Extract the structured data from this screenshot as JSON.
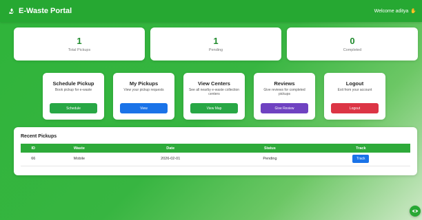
{
  "navbar": {
    "brand": "E-Waste Portal",
    "brand_icon": "recycle-icon",
    "welcome": "Welcome aditya",
    "welcome_icon": "wave-icon"
  },
  "stats": [
    {
      "value": "1",
      "label": "Total Pickups"
    },
    {
      "value": "1",
      "label": "Pending"
    },
    {
      "value": "0",
      "label": "Completed"
    }
  ],
  "actions": [
    {
      "title": "Schedule Pickup",
      "desc": "Book pickup for e-waste",
      "button": "Schedule",
      "color": "#28a745"
    },
    {
      "title": "My Pickups",
      "desc": "View your pickup requests",
      "button": "View",
      "color": "#1a73e8"
    },
    {
      "title": "View Centers",
      "desc": "See all nearby e-waste collection centers",
      "button": "View Map",
      "color": "#28a745"
    },
    {
      "title": "Reviews",
      "desc": "Give reviews for completed pickups",
      "button": "Give Review",
      "color": "#6f42c1"
    },
    {
      "title": "Logout",
      "desc": "Exit from your account",
      "button": "Logout",
      "color": "#dc3545"
    }
  ],
  "recent": {
    "title": "Recent Pickups",
    "columns": [
      "ID",
      "Waste",
      "Date",
      "Status",
      "Track"
    ],
    "rows": [
      {
        "id": "66",
        "waste": "Mobile",
        "date": "2026-02-01",
        "status": "Pending",
        "track": "Track"
      }
    ]
  },
  "colors": {
    "primary_green": "#26a832",
    "blue": "#1a73e8",
    "purple": "#6f42c1",
    "red": "#dc3545"
  },
  "fab_icon": "eye-icon"
}
